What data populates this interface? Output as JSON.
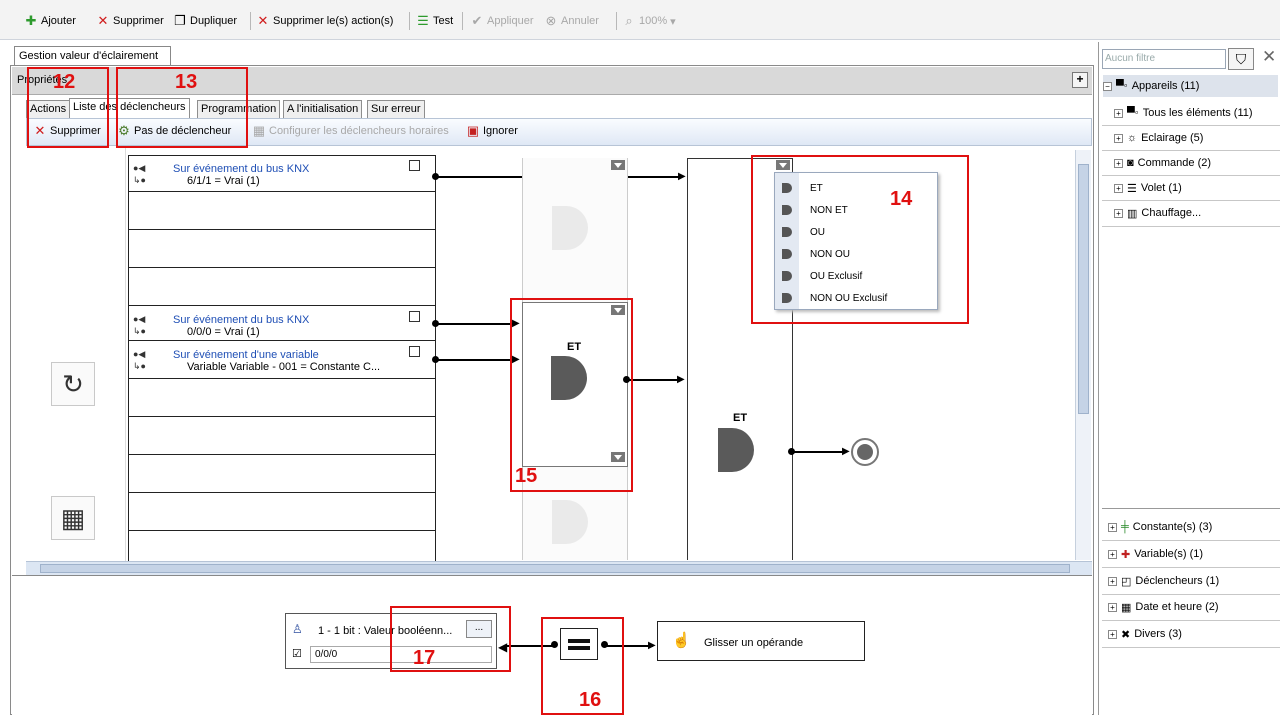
{
  "toolbar": {
    "add": "Ajouter",
    "delete": "Supprimer",
    "duplicate": "Dupliquer",
    "delete_actions": "Supprimer le(s) action(s)",
    "test": "Test",
    "apply": "Appliquer",
    "cancel": "Annuler",
    "zoom": "100%"
  },
  "doc_tab": "Gestion valeur d'éclairement",
  "properties_label": "Propriétés",
  "subtabs": [
    "Actions",
    "Liste des déclencheurs",
    "Programmation",
    "A l'initialisation",
    "Sur erreur"
  ],
  "trigger_toolbar": {
    "delete": "Supprimer",
    "no_trigger": "Pas de déclencheur",
    "configure": "Configurer les déclencheurs horaires",
    "ignore": "Ignorer"
  },
  "triggers": [
    {
      "title": "Sur événement du bus KNX",
      "desc": "6/1/1 = Vrai (1)"
    },
    {
      "title": "Sur événement du bus KNX",
      "desc": "0/0/0 = Vrai (1)"
    },
    {
      "title": "Sur événement d'une variable",
      "desc": "Variable Variable - 001 = Constante C..."
    }
  ],
  "gate_label": "ET",
  "gate_label2": "ET",
  "logic_menu": [
    "ET",
    "NON ET",
    "OU",
    "NON OU",
    "OU Exclusif",
    "NON OU Exclusif"
  ],
  "annotations": {
    "n12": "12",
    "n13": "13",
    "n14": "14",
    "n15": "15",
    "n16": "16",
    "n17": "17"
  },
  "operand": {
    "label": "1 - 1 bit : Valeur booléenn...",
    "browse": "...",
    "address": "0/0/0"
  },
  "drag_operand": "Glisser un opérande",
  "right_panel": {
    "filter_placeholder": "Aucun filtre",
    "devices": "Appareils (11)",
    "all_elements": "Tous les éléments (11)",
    "lighting": "Eclairage (5)",
    "command": "Commande (2)",
    "shutter": "Volet (1)",
    "heating": "Chauffage...",
    "constants": "Constante(s) (3)",
    "variables": "Variable(s) (1)",
    "triggers": "Déclencheurs (1)",
    "datetime": "Date et heure (2)",
    "misc": "Divers (3)"
  },
  "colors": {
    "annotation": "#e01010",
    "link": "#1f4fb5",
    "toolbar_bg": "#f3f3f3"
  }
}
